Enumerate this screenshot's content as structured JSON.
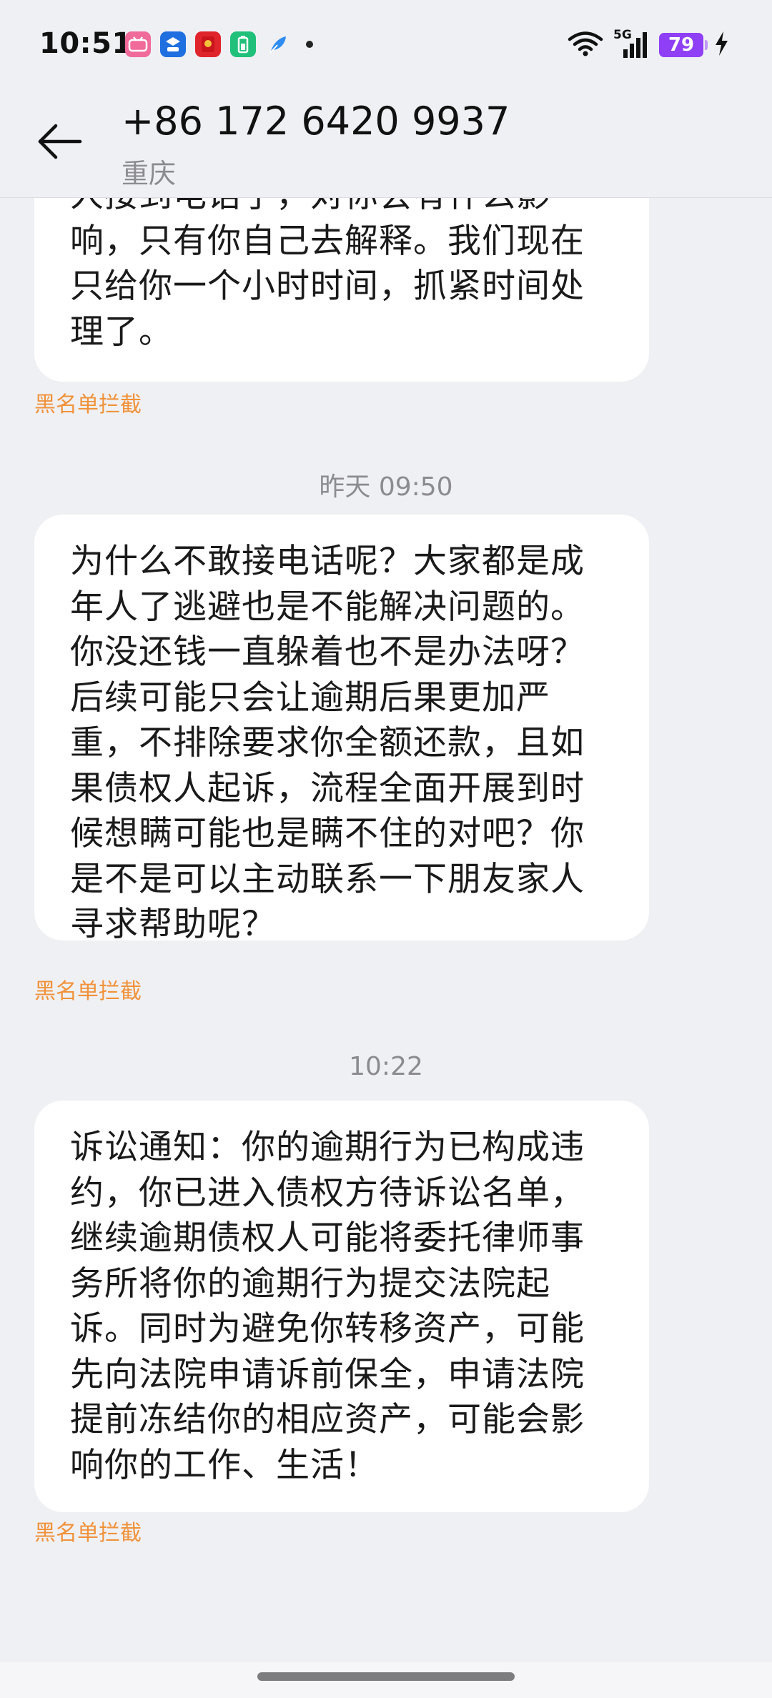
{
  "status_bar": {
    "time": "10:51",
    "notification_icons": [
      "bilibili-icon",
      "ai-app-icon",
      "red-packet-icon",
      "battery-app-icon",
      "feather-icon"
    ],
    "network": "5G",
    "battery_level": "79"
  },
  "header": {
    "contact_number": "+86 172 6420 9937",
    "contact_location": "重庆"
  },
  "messages": [
    {
      "text": "人接到电话了，对你会有什么影响，只有你自己去解释。我们现在只给你一个小时时间，抓紧时间处理了。",
      "tag": "黑名单拦截"
    },
    {
      "timestamp": "昨天 09:50",
      "text": "为什么不敢接电话呢？大家都是成年人了逃避也是不能解决问题的。你没还钱一直躲着也不是办法呀？后续可能只会让逾期后果更加严重，不排除要求你全额还款，且如果债权人起诉，流程全面开展到时候想瞒可能也是瞒不住的对吧？你是不是可以主动联系一下朋友家人寻求帮助呢？",
      "tag": "黑名单拦截"
    },
    {
      "timestamp": "10:22",
      "text": "诉讼通知：你的逾期行为已构成违约，你已进入债权方待诉讼名单，继续逾期债权人可能将委托律师事务所将你的逾期行为提交法院起诉。同时为避免你转移资产，可能先向法院申请诉前保全，申请法院提前冻结你的相应资产，可能会影响你的工作、生活！",
      "tag": "黑名单拦截"
    }
  ]
}
